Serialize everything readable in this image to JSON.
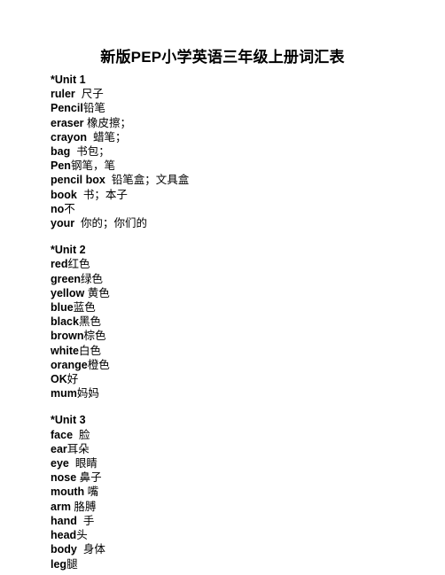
{
  "document": {
    "title": "新版PEP小学英语三年级上册词汇表",
    "background_color": "#ffffff",
    "text_color": "#000000"
  },
  "units": [
    {
      "heading": "*Unit 1",
      "entries": [
        {
          "en": "ruler",
          "sep": "  ",
          "zh": "尺子"
        },
        {
          "en": "Pencil",
          "sep": "",
          "zh": "铅笔"
        },
        {
          "en": "eraser",
          "sep": " ",
          "zh": "橡皮擦；"
        },
        {
          "en": "crayon",
          "sep": "  ",
          "zh": "蜡笔；"
        },
        {
          "en": "bag",
          "sep": "  ",
          "zh": "书包；"
        },
        {
          "en": "Pen",
          "sep": "",
          "zh": "钢笔，笔"
        },
        {
          "en": "pencil box",
          "sep": "  ",
          "zh": "铅笔盒；文具盒"
        },
        {
          "en": "book",
          "sep": "  ",
          "zh": "书；本子"
        },
        {
          "en": "no",
          "sep": "",
          "zh": "不"
        },
        {
          "en": "your",
          "sep": "  ",
          "zh": "你的；你们的"
        }
      ]
    },
    {
      "heading": "*Unit 2",
      "entries": [
        {
          "en": "red",
          "sep": "",
          "zh": "红色"
        },
        {
          "en": "green",
          "sep": "",
          "zh": "绿色"
        },
        {
          "en": "yellow",
          "sep": " ",
          "zh": "黄色"
        },
        {
          "en": "blue",
          "sep": "",
          "zh": "蓝色"
        },
        {
          "en": "black",
          "sep": "",
          "zh": "黑色"
        },
        {
          "en": "brown",
          "sep": "",
          "zh": "棕色"
        },
        {
          "en": "white",
          "sep": "",
          "zh": "白色"
        },
        {
          "en": "orange",
          "sep": "",
          "zh": "橙色"
        },
        {
          "en": "OK",
          "sep": "",
          "zh": "好"
        },
        {
          "en": "mum",
          "sep": "",
          "zh": "妈妈"
        }
      ]
    },
    {
      "heading": "*Unit 3",
      "entries": [
        {
          "en": "face",
          "sep": "  ",
          "zh": "脸"
        },
        {
          "en": "ear",
          "sep": "",
          "zh": "耳朵"
        },
        {
          "en": "eye",
          "sep": "  ",
          "zh": "眼睛"
        },
        {
          "en": "nose",
          "sep": " ",
          "zh": "鼻子"
        },
        {
          "en": "mouth",
          "sep": " ",
          "zh": "嘴"
        },
        {
          "en": "arm",
          "sep": " ",
          "zh": "胳膊"
        },
        {
          "en": "hand",
          "sep": "  ",
          "zh": "手"
        },
        {
          "en": "head",
          "sep": "",
          "zh": "头"
        },
        {
          "en": "body",
          "sep": "  ",
          "zh": "身体"
        },
        {
          "en": "leg",
          "sep": "",
          "zh": "腿"
        }
      ]
    }
  ]
}
